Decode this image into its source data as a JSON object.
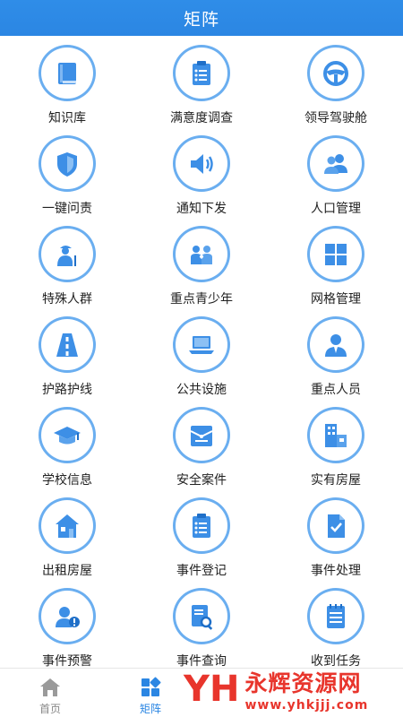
{
  "header": {
    "title": "矩阵"
  },
  "grid": [
    {
      "label": "知识库",
      "icon": "book-icon"
    },
    {
      "label": "满意度调查",
      "icon": "clipboard-icon"
    },
    {
      "label": "领导驾驶舱",
      "icon": "steering-wheel-icon"
    },
    {
      "label": "一键问责",
      "icon": "shield-icon"
    },
    {
      "label": "通知下发",
      "icon": "speaker-icon"
    },
    {
      "label": "人口管理",
      "icon": "people-icon"
    },
    {
      "label": "特殊人群",
      "icon": "elderly-icon"
    },
    {
      "label": "重点青少年",
      "icon": "youth-icon"
    },
    {
      "label": "网格管理",
      "icon": "grid-icon"
    },
    {
      "label": "护路护线",
      "icon": "road-icon"
    },
    {
      "label": "公共设施",
      "icon": "laptop-icon"
    },
    {
      "label": "重点人员",
      "icon": "person-icon"
    },
    {
      "label": "学校信息",
      "icon": "graduation-cap-icon"
    },
    {
      "label": "安全案件",
      "icon": "case-box-icon"
    },
    {
      "label": "实有房屋",
      "icon": "building-icon"
    },
    {
      "label": "出租房屋",
      "icon": "house-icon"
    },
    {
      "label": "事件登记",
      "icon": "clipboard-icon"
    },
    {
      "label": "事件处理",
      "icon": "document-check-icon"
    },
    {
      "label": "事件预警",
      "icon": "alert-icon"
    },
    {
      "label": "事件查询",
      "icon": "document-search-icon"
    },
    {
      "label": "收到任务",
      "icon": "task-list-icon"
    }
  ],
  "tabs": [
    {
      "label": "首页",
      "icon": "home-icon",
      "active": false
    },
    {
      "label": "矩阵",
      "icon": "matrix-icon",
      "active": true
    },
    {
      "label": "",
      "icon": "",
      "active": false
    },
    {
      "label": "",
      "icon": "",
      "active": false
    }
  ],
  "watermark": {
    "logo": "YH",
    "title": "永辉资源网",
    "url": "www.yhkjjj.com"
  },
  "colors": {
    "primary": "#2b86e3",
    "icon_blue": "#3d8fe6",
    "ring": "#6aaef0",
    "watermark": "#e8352c"
  }
}
